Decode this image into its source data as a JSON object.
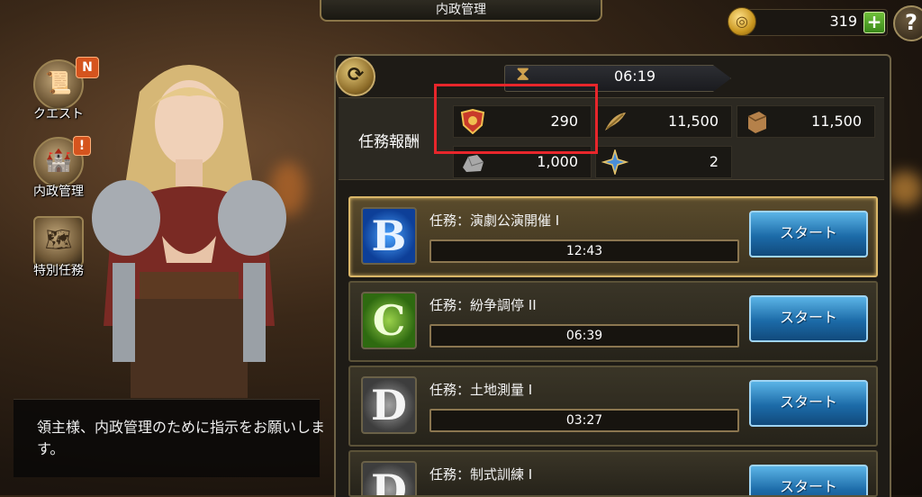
{
  "header": {
    "title": "内政管理"
  },
  "currency": {
    "coins": "319",
    "plus_label": "+",
    "help_label": "?"
  },
  "side_menu": [
    {
      "label": "クエスト",
      "badge": "N"
    },
    {
      "label": "内政管理",
      "badge": "!"
    },
    {
      "label": "特別任務",
      "badge": ""
    }
  ],
  "dialogue": {
    "text": "領主様、内政管理のために指示をお願いします。"
  },
  "timer": {
    "value": "06:19"
  },
  "rewards": {
    "label": "任務報酬",
    "items": [
      {
        "icon": "emblem-icon",
        "value": "290"
      },
      {
        "icon": "wheat-icon",
        "value": "11,500"
      },
      {
        "icon": "wood-icon",
        "value": "11,500"
      },
      {
        "icon": "stone-icon",
        "value": "1,000"
      },
      {
        "icon": "compass-star-icon",
        "value": "2"
      }
    ]
  },
  "tasks": [
    {
      "rank": "B",
      "name": "任務：演劇公演開催 I",
      "time": "12:43",
      "button": "スタート"
    },
    {
      "rank": "C",
      "name": "任務：紛争調停 II",
      "time": "06:39",
      "button": "スタート"
    },
    {
      "rank": "D",
      "name": "任務：土地測量 I",
      "time": "03:27",
      "button": "スタート"
    },
    {
      "rank": "D",
      "name": "任務：制式訓練 I",
      "time": "",
      "button": "スタート"
    }
  ],
  "colors": {
    "highlight": "#e8262b",
    "start_button": "#1c6ba8",
    "selected_border": "#d9b668"
  }
}
